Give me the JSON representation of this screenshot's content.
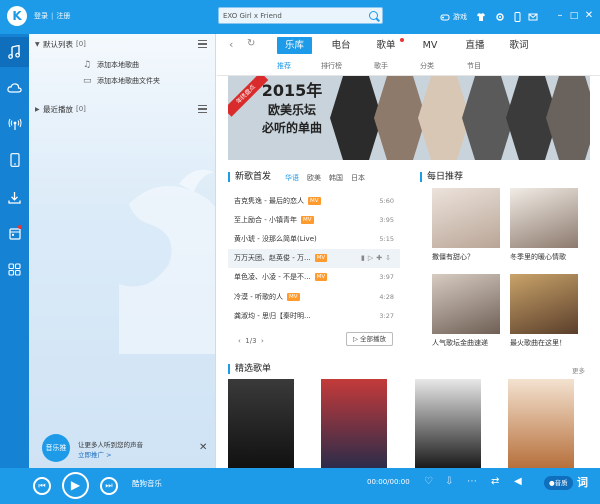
{
  "titlebar": {
    "logo": "K",
    "login": "登录",
    "separator": "|",
    "register": "注册",
    "search_value": "EXO Girl x Friend",
    "game_label": "游戏",
    "icons": [
      "game-icon",
      "shirt-icon",
      "settings-icon",
      "mobile-icon",
      "mail-icon",
      "minimize-icon",
      "maximize-icon",
      "close-icon"
    ]
  },
  "sidebar_icons": [
    "music-note-icon",
    "cloud-icon",
    "radio-icon",
    "phone-icon",
    "download-icon",
    "calendar-icon",
    "apps-icon"
  ],
  "left": {
    "default_list": "默认列表",
    "default_count": "[0]",
    "add_song": "添加本地歌曲",
    "add_folder": "添加本地歌曲文件夹",
    "recent": "最近播放",
    "recent_count": "[0]",
    "promo_badge": "音乐推",
    "promo_line1": "让更多人听到您的声音",
    "promo_link": "立即推广",
    "promo_arrow": ">"
  },
  "nav": {
    "tabs": [
      "乐库",
      "电台",
      "歌单",
      "MV",
      "直播",
      "歌词"
    ],
    "active_tab": "乐库",
    "subtabs": [
      "推荐",
      "排行榜",
      "歌手",
      "分类",
      "节目"
    ]
  },
  "banner": {
    "ribbon": "年终盘点",
    "year": "2015年",
    "line2": "欧美乐坛",
    "line3": "必听的单曲"
  },
  "new_songs": {
    "title": "新歌首发",
    "filters": [
      "华语",
      "欧美",
      "韩国",
      "日本"
    ],
    "active_filter": "华语",
    "songs": [
      {
        "name": "吉克隽逸 - 最后的恋人",
        "mv": true,
        "duration": "5:60"
      },
      {
        "name": "至上励合 - 小镇青年",
        "mv": true,
        "duration": "3:95"
      },
      {
        "name": "黄小琥 - 没那么简单(Live)",
        "mv": false,
        "duration": "5:15"
      },
      {
        "name": "万万天团、赵英俊 - 万...",
        "mv": true,
        "duration": ""
      },
      {
        "name": "单色凌、小凌 - 不是不...",
        "mv": true,
        "duration": "3:97"
      },
      {
        "name": "冷漠 - 听歌的人",
        "mv": true,
        "duration": "4:28"
      },
      {
        "name": "龚淑均 - 思归【秦时明...",
        "mv": false,
        "duration": "3:27"
      }
    ],
    "page": "1/3",
    "play_all": "全部播放"
  },
  "daily": {
    "title": "每日推荐",
    "items": [
      "撒僵有甜心？",
      "冬季里的暖心情歌",
      "人气歌坛金曲速递",
      "最火歌曲在这里！"
    ]
  },
  "playlists": {
    "title": "精选歌单",
    "more": "更多"
  },
  "player": {
    "title": "酷狗音乐",
    "time": "00:00/00:00",
    "quality": "音质",
    "lyric": "词"
  },
  "colors": {
    "brand": "#1d9ae8",
    "accent_red": "#d92b2b",
    "mv_badge": "#ff9a2e"
  }
}
